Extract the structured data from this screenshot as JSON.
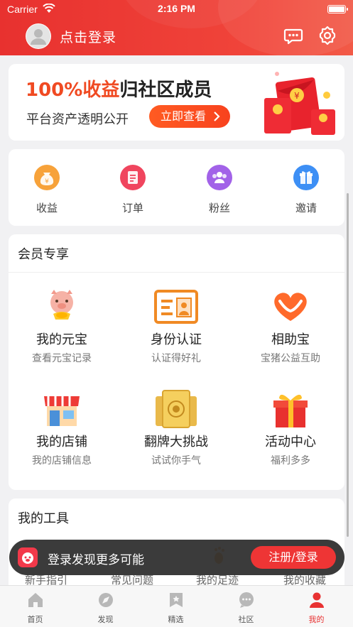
{
  "status_bar": {
    "carrier": "Carrier",
    "time": "2:16 PM"
  },
  "header": {
    "login_text": "点击登录"
  },
  "banner": {
    "headline_highlight": "100%收益",
    "headline_rest": "归社区成员",
    "subtitle": "平台资产透明公开",
    "cta_label": "立即查看"
  },
  "quick_actions": [
    {
      "label": "收益",
      "icon": "money-bag-icon",
      "color": "#f7a23a"
    },
    {
      "label": "订单",
      "icon": "order-clipboard-icon",
      "color": "#f0455e"
    },
    {
      "label": "粉丝",
      "icon": "fans-group-icon",
      "color": "#a262e8"
    },
    {
      "label": "邀请",
      "icon": "gift-icon",
      "color": "#3d8ff5"
    }
  ],
  "member": {
    "title": "会员专享",
    "items": [
      {
        "name": "我的元宝",
        "desc": "查看元宝记录",
        "icon": "pig-ingot-icon"
      },
      {
        "name": "身份认证",
        "desc": "认证得好礼",
        "icon": "id-card-icon"
      },
      {
        "name": "相助宝",
        "desc": "宝猪公益互助",
        "icon": "heart-hands-icon"
      },
      {
        "name": "我的店铺",
        "desc": "我的店铺信息",
        "icon": "shop-icon"
      },
      {
        "name": "翻牌大挑战",
        "desc": "试试你手气",
        "icon": "gold-cards-icon"
      },
      {
        "name": "活动中心",
        "desc": "福利多多",
        "icon": "gift-box-icon"
      }
    ]
  },
  "tools": {
    "title": "我的工具",
    "items": [
      "新手指引",
      "常见问题",
      "我的足迹",
      "我的收藏"
    ]
  },
  "toast": {
    "message": "登录发现更多可能",
    "button": "注册/登录"
  },
  "tabbar": {
    "tabs": [
      {
        "label": "首页",
        "icon": "home-icon"
      },
      {
        "label": "发现",
        "icon": "discover-icon"
      },
      {
        "label": "精选",
        "icon": "bookmark-star-icon"
      },
      {
        "label": "社区",
        "icon": "chat-bubble-icon"
      },
      {
        "label": "我的",
        "icon": "profile-icon"
      }
    ],
    "active_index": 4,
    "active_color": "#e83232"
  },
  "colors": {
    "brand_red": "#e8312f",
    "accent_orange": "#f04a22"
  }
}
